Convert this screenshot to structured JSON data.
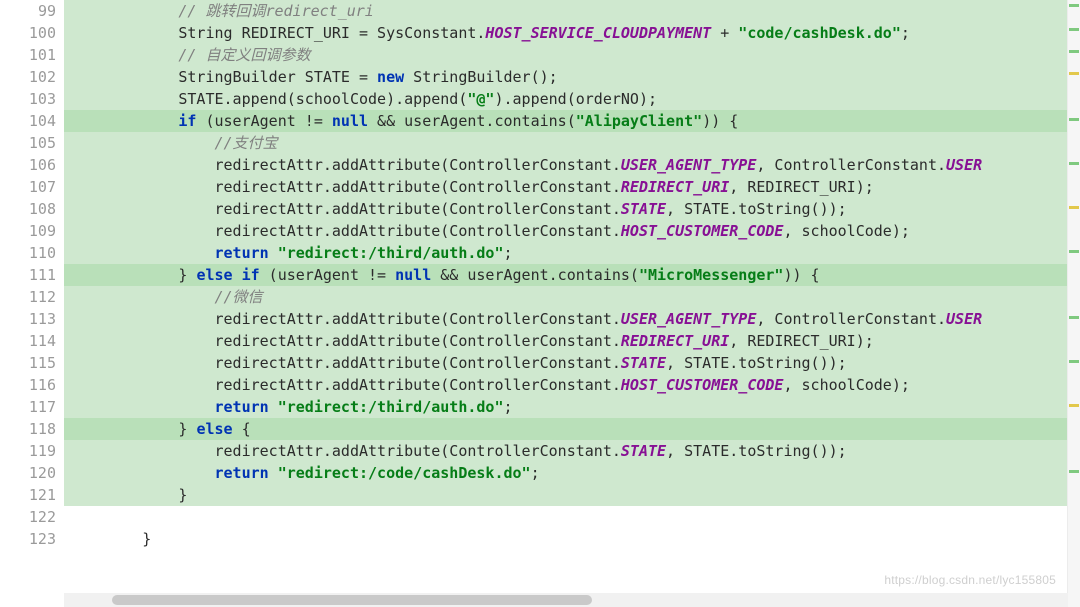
{
  "watermark": "https://blog.csdn.net/lyc155805",
  "gutter": {
    "start": 99,
    "end": 123
  },
  "tokens": {
    "kw_if": "if",
    "kw_else": "else",
    "kw_new": "new",
    "kw_null": "null",
    "kw_return": "return",
    "str_cashdesk": "\"code/cashDesk.do\"",
    "str_at": "\"@\"",
    "str_alipay": "\"AlipayClient\"",
    "str_micro": "\"MicroMessenger\"",
    "str_redirect_auth": "\"redirect:/third/auth.do\"",
    "str_redirect_desk": "\"redirect:/code/cashDesk.do\"",
    "fld_host_service": "HOST_SERVICE_CLOUDPAYMENT",
    "fld_user_agent_type": "USER_AGENT_TYPE",
    "fld_user_const": "USER",
    "fld_redirect_uri": "REDIRECT_URI",
    "fld_state": "STATE",
    "fld_host_cust": "HOST_CUSTOMER_CODE",
    "cmt99": "// 跳转回调redirect_uri",
    "cmt101": "// 自定义回调参数",
    "cmt105": "//支付宝",
    "cmt112": "//微信",
    "p100a": "            String REDIRECT_URI = SysConstant.",
    "p100b": " + ",
    "p100c": ";",
    "p102a": "            StringBuilder STATE = ",
    "p102b": " StringBuilder();",
    "p103": "            STATE.append(schoolCode).append(",
    "p103b": ").append(orderNO);",
    "p104a": "            ",
    "p104b": " (userAgent != ",
    "p104c": " && userAgent.contains(",
    "p104d": ")) {",
    "p106a": "                redirectAttr.addAttribute(ControllerConstant.",
    "p106b": ", ControllerConstant.",
    "p107b": ", REDIRECT_URI);",
    "p108b": ", STATE.toString());",
    "p109b": ", schoolCode);",
    "p110a": "                ",
    "p110b": " ",
    "p110c": ";",
    "p111a": "            } ",
    "p111b": " ",
    "p111c": " (userAgent != ",
    "p111d": " && userAgent.contains(",
    "p111e": ")) {",
    "p118a": "            } ",
    "p118b": " {",
    "p121": "            }",
    "p123": "        }",
    "ind16": "                ",
    "ind12": "            "
  }
}
